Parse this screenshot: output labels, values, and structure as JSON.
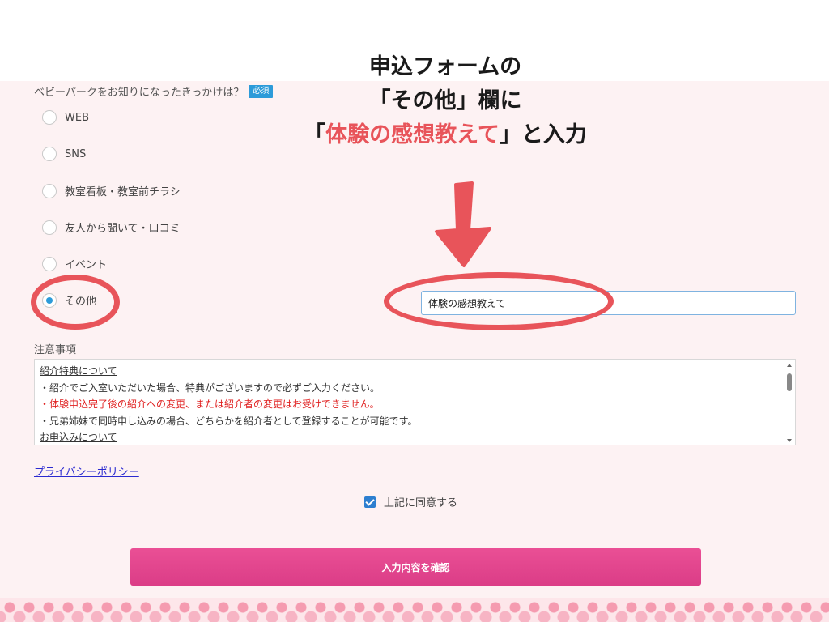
{
  "form": {
    "question": "ベビーパークをお知りになったきっかけは？",
    "required_badge": "必須",
    "options": [
      {
        "label": "WEB",
        "checked": false
      },
      {
        "label": "SNS",
        "checked": false
      },
      {
        "label": "教室看板・教室前チラシ",
        "checked": false
      },
      {
        "label": "友人から聞いて・口コミ",
        "checked": false
      },
      {
        "label": "イベント",
        "checked": false
      },
      {
        "label": "その他",
        "checked": true
      }
    ],
    "other_value": "体験の感想教えて"
  },
  "notes": {
    "title": "注意事項",
    "lines": [
      "紹介特典について",
      "・紹介でご入室いただいた場合、特典がございますので必ずご入力ください。",
      "・体験申込完了後の紹介への変更、または紹介者の変更はお受けできません。",
      "・兄弟姉妹で同時申し込みの場合、どちらかを紹介者として登録することが可能です。",
      "お申込みについて"
    ]
  },
  "privacy_link": "プライバシーポリシー",
  "agree_label": "上記に同意する",
  "agree_checked": true,
  "confirm_button": "入力内容を確認",
  "annotation": {
    "line1": "申込フォームの",
    "line2": "「その他」欄に",
    "line3_open": "「",
    "line3_highlight": "体験の感想教えて",
    "line3_close": "」と入力"
  },
  "colors": {
    "accent_blue": "#2d9bd9",
    "annotation_red": "#e8545a",
    "button_pink": "#e2448c",
    "form_background": "#fdf2f3"
  }
}
